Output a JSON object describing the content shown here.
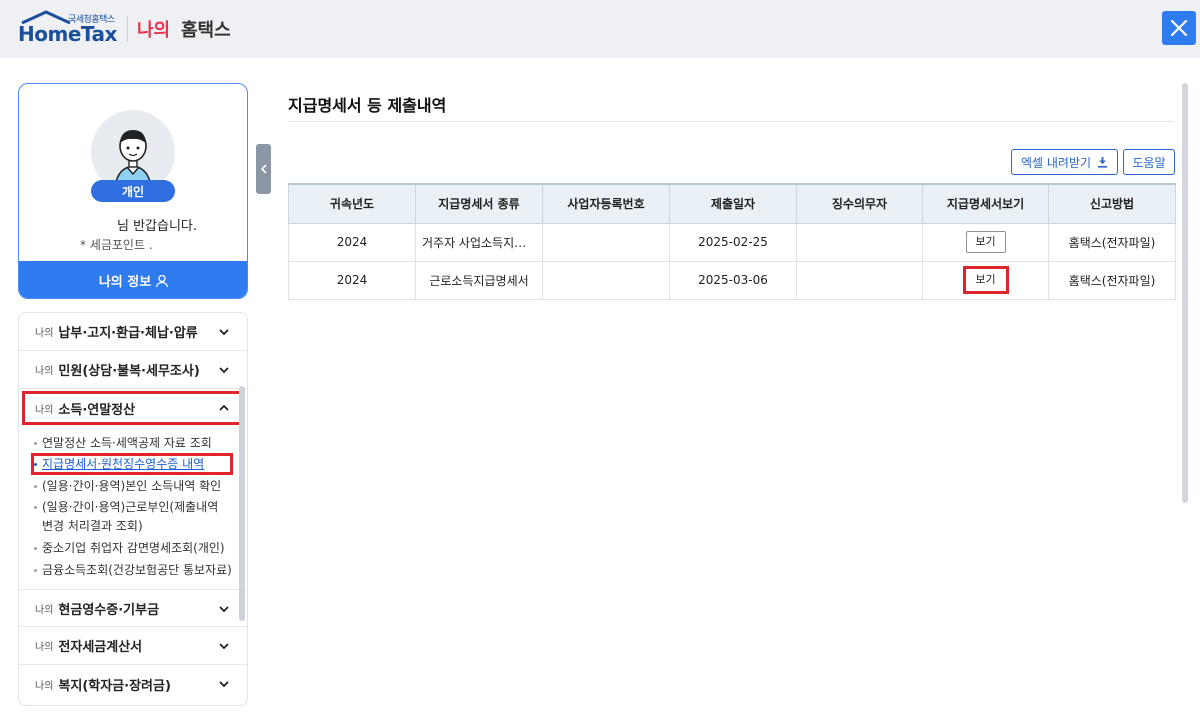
{
  "header": {
    "logo_small": "국세청홈택스",
    "logo_text": "HomeTax",
    "brand_my": "나의",
    "brand_hometax": "홈택스",
    "close_icon": "close-icon"
  },
  "profile": {
    "badge": "개인",
    "greeting": "님 반갑습니다.",
    "point": "* 세금포인트 .",
    "my_info_button": "나의 정보"
  },
  "menu": {
    "prefix": "나의",
    "items": [
      {
        "label": "납부·고지·환급·체납·압류"
      },
      {
        "label": "민원(상담·불복·세무조사)"
      },
      {
        "label": "소득·연말정산"
      },
      {
        "label": "현금영수증·기부금"
      },
      {
        "label": "전자세금계산서"
      },
      {
        "label": "복지(학자금·장려금)"
      }
    ],
    "submenu": [
      {
        "label": "연말정산 소득·세액공제 자료 조회"
      },
      {
        "label": "지급명세서·원천징수영수증 내역"
      },
      {
        "label": "(일용·간이·용역)본인 소득내역 확인"
      },
      {
        "label": "(일용·간이·용역)근로부인(제출내역"
      },
      {
        "label": "변경 처리결과 조회)"
      },
      {
        "label": "중소기업 취업자 감면명세조회(개인)"
      },
      {
        "label": "금융소득조회(건강보험공단 통보자료)"
      }
    ]
  },
  "main": {
    "title": "지급명세서 등 제출내역",
    "excel_button": "엑셀 내려받기",
    "help_button": "도움말",
    "columns": [
      "귀속년도",
      "지급명세서 종류",
      "사업자등록번호",
      "제출일자",
      "징수의무자",
      "지급명세서보기",
      "신고방법"
    ],
    "rows": [
      {
        "year": "2024",
        "type": "거주자 사업소득지급명세서",
        "bizno": "",
        "date": "2025-02-25",
        "payer": "",
        "view": "보기",
        "method": "홈택스(전자파일)"
      },
      {
        "year": "2024",
        "type": "근로소득지급명세서",
        "bizno": "",
        "date": "2025-03-06",
        "payer": "",
        "view": "보기",
        "method": "홈택스(전자파일)"
      }
    ]
  },
  "colors": {
    "accent": "#2f7bf0",
    "brand_red": "#e8344e",
    "highlight": "#e0242b"
  }
}
